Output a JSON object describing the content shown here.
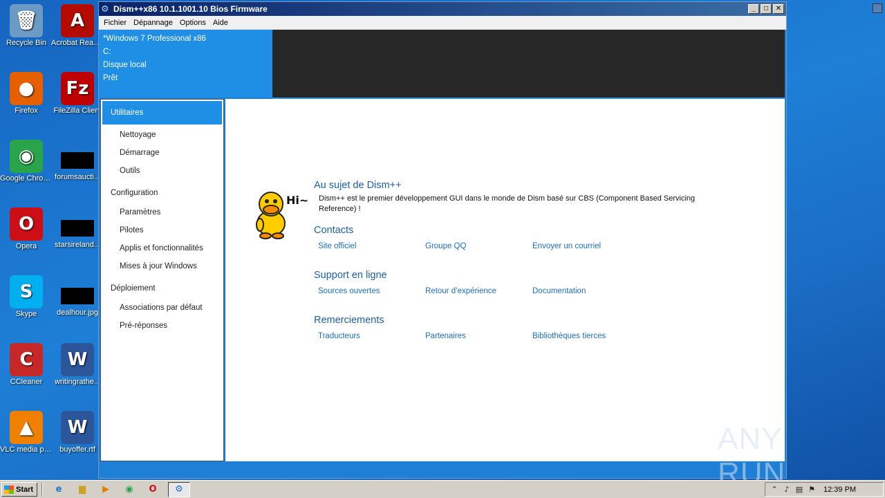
{
  "desktop": {
    "icons": [
      {
        "label": "Recycle Bin",
        "icon": "recycle-bin-icon",
        "glyph": "🗑",
        "color": "#6b9ac4"
      },
      {
        "label": "Acrobat Reader DC",
        "icon": "acrobat-icon",
        "glyph": "A",
        "color": "#b30b00"
      },
      {
        "label": "Firefox",
        "icon": "firefox-icon",
        "glyph": "●",
        "color": "#e66000"
      },
      {
        "label": "FileZilla Client",
        "icon": "filezilla-icon",
        "glyph": "Fz",
        "color": "#bf0000"
      },
      {
        "label": "Google Chrome",
        "icon": "chrome-icon",
        "glyph": "◉",
        "color": "#2aa44a"
      },
      {
        "label": "forumsaucti...",
        "icon": "file-thumbnail-icon",
        "glyph": "",
        "color": "#000000"
      },
      {
        "label": "Opera",
        "icon": "opera-icon",
        "glyph": "O",
        "color": "#cc0f16"
      },
      {
        "label": "starsireland...",
        "icon": "file-thumbnail-icon",
        "glyph": "",
        "color": "#000000"
      },
      {
        "label": "Skype",
        "icon": "skype-icon",
        "glyph": "S",
        "color": "#00aff0"
      },
      {
        "label": "dealhour.jpg",
        "icon": "image-file-icon",
        "glyph": "",
        "color": "#000000"
      },
      {
        "label": "CCleaner",
        "icon": "ccleaner-icon",
        "glyph": "C",
        "color": "#c62828"
      },
      {
        "label": "writingrathe...",
        "icon": "word-document-icon",
        "glyph": "W",
        "color": "#2b579a"
      },
      {
        "label": "VLC media player",
        "icon": "vlc-icon",
        "glyph": "▲",
        "color": "#f08000"
      },
      {
        "label": "buyoffer.rtf",
        "icon": "word-document-icon",
        "glyph": "W",
        "color": "#2b579a"
      }
    ]
  },
  "window": {
    "title": "Dism++x86 10.1.1001.10 Bios Firmware",
    "menu": [
      "Fichier",
      "Dépannage",
      "Options",
      "Aide"
    ],
    "info": {
      "os": "*Windows 7 Professional x86",
      "drive": "C:",
      "disk": "Disque local",
      "status": "Prêt"
    },
    "nav": {
      "active": "Utilitaires",
      "utilities_items": [
        "Nettoyage",
        "Démarrage",
        "Outils"
      ],
      "configuration_label": "Configuration",
      "configuration_items": [
        "Paramètres",
        "Pilotes",
        "Applis et fonctionnalités",
        "Mises à jour Windows"
      ],
      "deployment_label": "Déploiement",
      "deployment_items": [
        "Associations par défaut",
        "Pré-réponses"
      ]
    },
    "about": {
      "title": "Au sujet de Dism++",
      "text": "Dism++ est le premier développement GUI dans le monde de Dism basé sur CBS (Component Based Servicing Reference) !",
      "contacts_title": "Contacts",
      "contacts": [
        "Site officiel",
        "Groupe QQ",
        "Envoyer un courriel"
      ],
      "support_title": "Support en ligne",
      "support": [
        "Sources ouvertes",
        "Retour d’expérience",
        "Documentation"
      ],
      "thanks_title": "Remerciements",
      "thanks": [
        "Traducteurs",
        "Partenaires",
        "Bibliothèques tierces"
      ],
      "mascot_text": "Hi~"
    }
  },
  "watermark": "ANY RUN",
  "taskbar": {
    "start_label": "Start",
    "clock": "12:39 PM"
  },
  "colors": {
    "accent": "#1e8fe5",
    "link": "#1a6fc4",
    "heading": "#1d5fae",
    "dark_panel": "#272727"
  }
}
